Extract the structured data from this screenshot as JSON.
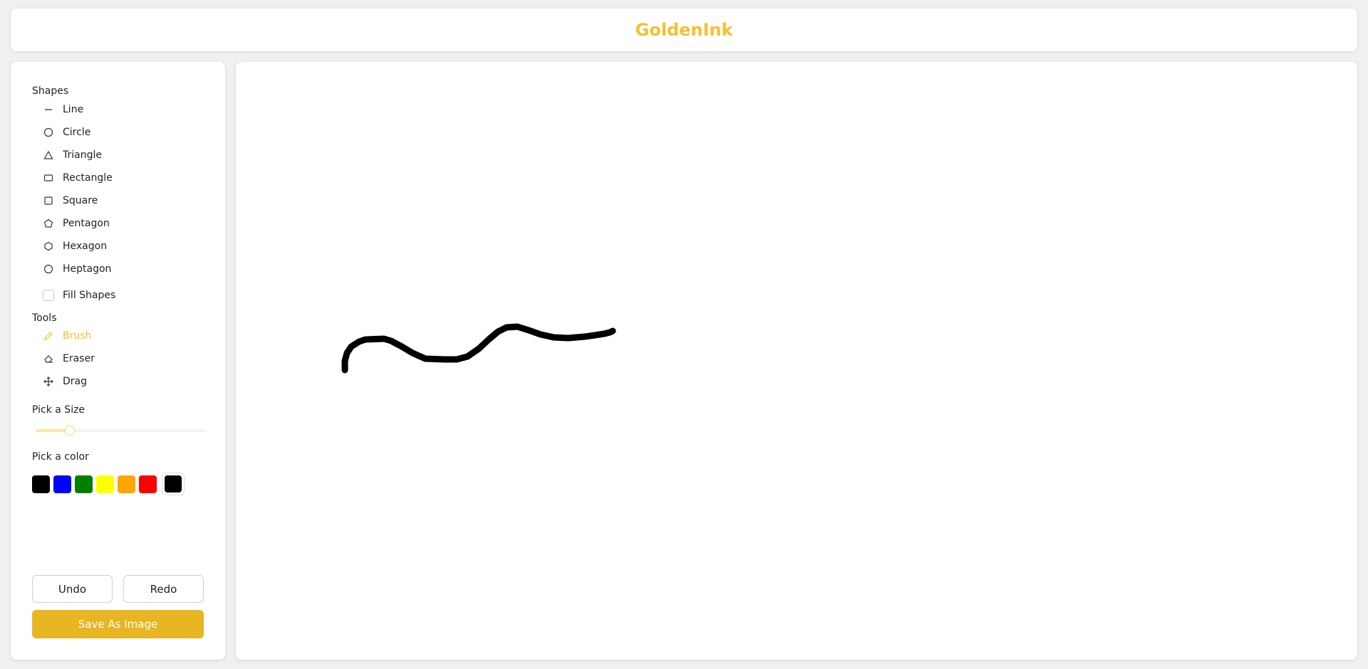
{
  "app": {
    "title": "GoldenInk",
    "brand_color": "#f5c030"
  },
  "sidebar": {
    "shapes_title": "Shapes",
    "shapes": [
      {
        "label": "Line",
        "icon": "line-icon"
      },
      {
        "label": "Circle",
        "icon": "circle-icon"
      },
      {
        "label": "Triangle",
        "icon": "triangle-icon"
      },
      {
        "label": "Rectangle",
        "icon": "rectangle-icon"
      },
      {
        "label": "Square",
        "icon": "square-icon"
      },
      {
        "label": "Pentagon",
        "icon": "pentagon-icon"
      },
      {
        "label": "Hexagon",
        "icon": "hexagon-icon"
      },
      {
        "label": "Heptagon",
        "icon": "heptagon-icon"
      }
    ],
    "fill_shapes_label": "Fill Shapes",
    "fill_shapes_checked": false,
    "tools_title": "Tools",
    "tools": [
      {
        "label": "Brush",
        "icon": "brush-icon",
        "active": true
      },
      {
        "label": "Eraser",
        "icon": "eraser-icon",
        "active": false
      },
      {
        "label": "Drag",
        "icon": "move-icon",
        "active": false
      }
    ],
    "size_title": "Pick a Size",
    "size_value_fraction": 0.2,
    "color_title": "Pick a color",
    "colors": [
      "#000000",
      "#0000ff",
      "#008000",
      "#ffff00",
      "#ffa500",
      "#ff0000"
    ],
    "current_color": "#000000",
    "undo_label": "Undo",
    "redo_label": "Redo",
    "save_label": "Save As Image",
    "accent_color": "#e8b523"
  },
  "canvas": {
    "stroke_color": "#000000"
  }
}
